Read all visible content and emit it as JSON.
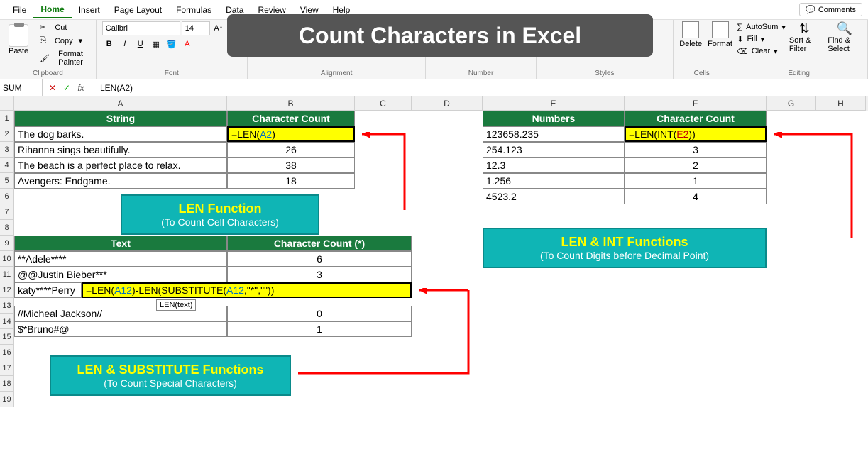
{
  "menu": {
    "items": [
      "File",
      "Home",
      "Insert",
      "Page Layout",
      "Formulas",
      "Data",
      "Review",
      "View",
      "Help"
    ],
    "active_index": 1,
    "comments_label": "Comments"
  },
  "ribbon": {
    "clipboard": {
      "label": "Clipboard",
      "paste": "Paste",
      "cut": "Cut",
      "copy": "Copy",
      "format_painter": "Format Painter"
    },
    "font": {
      "label": "Font",
      "font_name": "Calibri",
      "font_size": "14"
    },
    "alignment": {
      "label": "Alignment"
    },
    "number": {
      "label": "Number"
    },
    "styles": {
      "label": "Styles"
    },
    "cells": {
      "label": "Cells",
      "delete": "Delete",
      "format": "Format"
    },
    "editing": {
      "label": "Editing",
      "autosum": "AutoSum",
      "fill": "Fill",
      "clear": "Clear",
      "sort_filter": "Sort & Filter",
      "find_select": "Find & Select"
    }
  },
  "title_overlay": "Count Characters in Excel",
  "formula_bar": {
    "name_box": "SUM",
    "formula": "=LEN(A2)"
  },
  "columns": [
    "A",
    "B",
    "C",
    "D",
    "E",
    "F",
    "G",
    "H"
  ],
  "col_widths": {
    "rowhdr": 20,
    "A": 300,
    "B": 180,
    "C": 80,
    "D": 100,
    "E": 200,
    "F": 200,
    "G": 70,
    "H": 70
  },
  "row_count": 19,
  "table1": {
    "hdr": {
      "A": "String",
      "B": "Character Count"
    },
    "rows": [
      {
        "A": "The dog barks.",
        "B_formula": "=LEN(A2)"
      },
      {
        "A": "Rihanna sings beautifully.",
        "B": "26"
      },
      {
        "A": "The beach is a perfect place to relax.",
        "B": "38"
      },
      {
        "A": "Avengers: Endgame.",
        "B": "18"
      }
    ]
  },
  "table2": {
    "hdr": {
      "A": "Text",
      "B": "Character Count (*)"
    },
    "rows": [
      {
        "A": "**Adele****",
        "B": "6"
      },
      {
        "A": " @@Justin Bieber***",
        "B": "3"
      },
      {
        "A": "katy****Perry",
        "B_formula": "=LEN(A12)-LEN(SUBSTITUTE(A12,\"*\",\"\"))"
      },
      {
        "A": "//Micheal Jackson//",
        "B": "0"
      },
      {
        "A": "$*Bruno#@",
        "B": "1"
      }
    ]
  },
  "table3": {
    "hdr": {
      "E": "Numbers",
      "F": "Character Count"
    },
    "rows": [
      {
        "E": "123658.235",
        "F_formula": "=LEN(INT(E2))"
      },
      {
        "E": "254.123",
        "F": "3"
      },
      {
        "E": "12.3",
        "F": "2"
      },
      {
        "E": "1.256",
        "F": "1"
      },
      {
        "E": "4523.2",
        "F": "4"
      }
    ]
  },
  "callouts": {
    "len": {
      "title": "LEN Function",
      "sub": "(To Count Cell Characters)"
    },
    "len_sub": {
      "title": "LEN & SUBSTITUTE Functions",
      "sub": "(To Count Special Characters)"
    },
    "len_int": {
      "title": "LEN & INT Functions",
      "sub": "(To Count Digits before Decimal Point)"
    }
  },
  "tooltip": "LEN(text)",
  "colors": {
    "header_green": "#1a7a3e",
    "highlight_yellow": "#ffff00",
    "callout_teal": "#0fb5b5",
    "callout_title": "#ffff00",
    "arrow_red": "#ff0000"
  }
}
